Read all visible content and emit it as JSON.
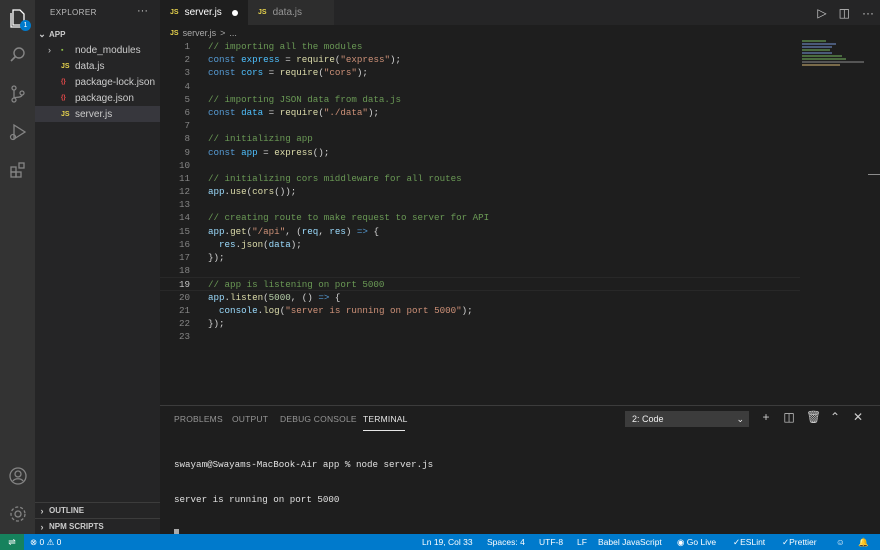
{
  "activity_bar": {
    "explorer_badge": "1"
  },
  "sidebar": {
    "title": "EXPLORER",
    "more": "···",
    "folder": "APP",
    "items": [
      {
        "label": "node_modules",
        "icon": "folder-icon",
        "badge": ""
      },
      {
        "label": "data.js",
        "icon": "js-file-icon",
        "badge": "JS"
      },
      {
        "label": "package-lock.json",
        "icon": "json-file-icon",
        "badge": "{}"
      },
      {
        "label": "package.json",
        "icon": "json-file-icon",
        "badge": "{}"
      },
      {
        "label": "server.js",
        "icon": "js-file-icon",
        "badge": "JS"
      }
    ],
    "outline": "OUTLINE",
    "npm_scripts": "NPM SCRIPTS"
  },
  "tabs": [
    {
      "label": "server.js",
      "badge": "JS",
      "active": true,
      "dirty": true
    },
    {
      "label": "data.js",
      "badge": "JS",
      "active": false,
      "dirty": false
    }
  ],
  "breadcrumb": {
    "badge": "JS",
    "file": "server.js",
    "separator": ">",
    "rest": "..."
  },
  "code": {
    "current_line": 19,
    "lines": [
      [
        [
          "t-com",
          "// importing all the modules"
        ]
      ],
      [
        [
          "t-kw",
          "const "
        ],
        [
          "t-cls",
          "express"
        ],
        [
          "t-pun",
          " = "
        ],
        [
          "t-fn",
          "require"
        ],
        [
          "t-pun",
          "("
        ],
        [
          "t-str",
          "\"express\""
        ],
        [
          "t-pun",
          ");"
        ]
      ],
      [
        [
          "t-kw",
          "const "
        ],
        [
          "t-cls",
          "cors"
        ],
        [
          "t-pun",
          " = "
        ],
        [
          "t-fn",
          "require"
        ],
        [
          "t-pun",
          "("
        ],
        [
          "t-str",
          "\"cors\""
        ],
        [
          "t-pun",
          ");"
        ]
      ],
      [],
      [
        [
          "t-com",
          "// importing JSON data from data.js"
        ]
      ],
      [
        [
          "t-kw",
          "const "
        ],
        [
          "t-cls",
          "data"
        ],
        [
          "t-pun",
          " = "
        ],
        [
          "t-fn",
          "require"
        ],
        [
          "t-pun",
          "("
        ],
        [
          "t-str",
          "\"./data\""
        ],
        [
          "t-pun",
          ");"
        ]
      ],
      [],
      [
        [
          "t-com",
          "// initializing app"
        ]
      ],
      [
        [
          "t-kw",
          "const "
        ],
        [
          "t-cls",
          "app"
        ],
        [
          "t-pun",
          " = "
        ],
        [
          "t-fn",
          "express"
        ],
        [
          "t-pun",
          "();"
        ]
      ],
      [],
      [
        [
          "t-com",
          "// initializing cors middleware for all routes"
        ]
      ],
      [
        [
          "t-var",
          "app"
        ],
        [
          "t-pun",
          "."
        ],
        [
          "t-fn",
          "use"
        ],
        [
          "t-pun",
          "("
        ],
        [
          "t-fn",
          "cors"
        ],
        [
          "t-pun",
          "());"
        ]
      ],
      [],
      [
        [
          "t-com",
          "// creating route to make request to server for API"
        ]
      ],
      [
        [
          "t-var",
          "app"
        ],
        [
          "t-pun",
          "."
        ],
        [
          "t-fn",
          "get"
        ],
        [
          "t-pun",
          "("
        ],
        [
          "t-str",
          "\"/api\""
        ],
        [
          "t-pun",
          ", ("
        ],
        [
          "t-var",
          "req"
        ],
        [
          "t-pun",
          ", "
        ],
        [
          "t-var",
          "res"
        ],
        [
          "t-pun",
          ") "
        ],
        [
          "t-kw",
          "=>"
        ],
        [
          "t-pun",
          " {"
        ]
      ],
      [
        [
          "t-pun",
          "  "
        ],
        [
          "t-var",
          "res"
        ],
        [
          "t-pun",
          "."
        ],
        [
          "t-fn",
          "json"
        ],
        [
          "t-pun",
          "("
        ],
        [
          "t-var",
          "data"
        ],
        [
          "t-pun",
          ");"
        ]
      ],
      [
        [
          "t-pun",
          "});"
        ]
      ],
      [],
      [
        [
          "t-com",
          "// app is listening on port 5000"
        ]
      ],
      [
        [
          "t-var",
          "app"
        ],
        [
          "t-pun",
          "."
        ],
        [
          "t-fn",
          "listen"
        ],
        [
          "t-pun",
          "("
        ],
        [
          "t-num",
          "5000"
        ],
        [
          "t-pun",
          ", () "
        ],
        [
          "t-kw",
          "=>"
        ],
        [
          "t-pun",
          " {"
        ]
      ],
      [
        [
          "t-pun",
          "  "
        ],
        [
          "t-var",
          "console"
        ],
        [
          "t-pun",
          "."
        ],
        [
          "t-fn",
          "log"
        ],
        [
          "t-pun",
          "("
        ],
        [
          "t-str",
          "\"server is running on port 5000\""
        ],
        [
          "t-pun",
          ");"
        ]
      ],
      [
        [
          "t-pun",
          "});"
        ]
      ],
      []
    ]
  },
  "panel": {
    "tabs": [
      "PROBLEMS",
      "OUTPUT",
      "DEBUG CONSOLE",
      "TERMINAL"
    ],
    "active_tab": "TERMINAL",
    "terminal_select": "2: Code",
    "terminal_lines": [
      "swayam@Swayams-MacBook-Air app % node server.js",
      "server is running on port 5000"
    ]
  },
  "status_bar": {
    "errors": "0",
    "warnings": "0",
    "position": "Ln 19, Col 33",
    "spaces": "Spaces: 4",
    "encoding": "UTF-8",
    "eol": "LF",
    "language": "Babel JavaScript",
    "go_live": "Go Live",
    "eslint": "ESLint",
    "prettier": "Prettier"
  },
  "colors": {
    "accent": "#007acc",
    "remote": "#16825d",
    "js_badge": "#e8d44d"
  }
}
